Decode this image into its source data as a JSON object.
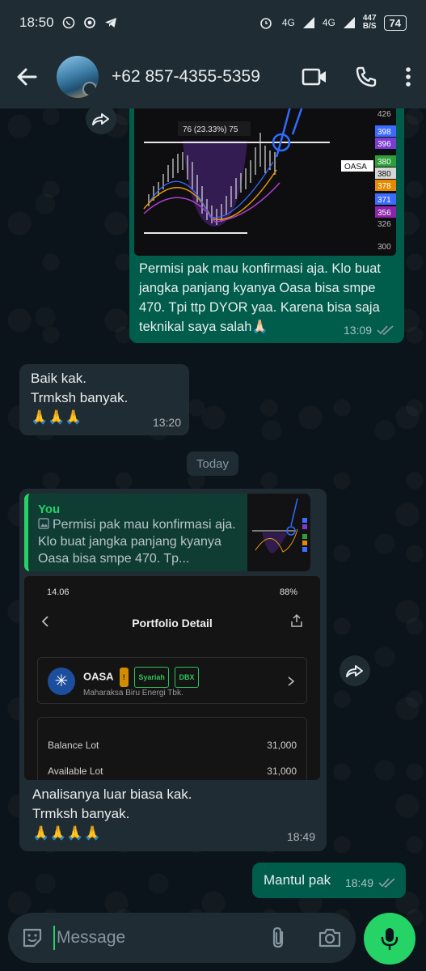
{
  "status_bar": {
    "time": "18:50",
    "net1": "4G",
    "net2": "4G",
    "speed_value": "447",
    "speed_unit": "B/S",
    "battery": "74"
  },
  "header": {
    "contact": "+62 857-4355-5359"
  },
  "chart_msg": {
    "ticker_label": "OASA",
    "callout": "76 (23.33%) 75",
    "price_ticks": [
      "426",
      "398",
      "396",
      "380",
      "380",
      "378",
      "371",
      "356",
      "326",
      "300"
    ],
    "price_tick_colors": [
      "#d0d0d0",
      "#3d6bff",
      "#7a3dd1",
      "#2e9e3a",
      "#d6d6d6",
      "#e58a00",
      "#3d6bff",
      "#8e24aa",
      "#d0d0d0",
      "#d0d0d0"
    ],
    "text": "Permisi pak mau konfirmasi aja. Klo buat jangka panjang kyanya Oasa bisa smpe 470. Tpi ttp DYOR yaa. Karena bisa saja teknikal saya salah🙏🏻",
    "time": "13:09"
  },
  "reply1": {
    "line1": "Baik kak.",
    "line2": "Trmksh banyak.",
    "line3": "🙏🙏🙏",
    "time": "13:20"
  },
  "date_divider": "Today",
  "reply2": {
    "quote_author": "You",
    "quote_text": "Permisi pak mau konfirmasi aja. Klo buat jangka panjang kyanya Oasa bisa smpe 470. Tp...",
    "screenshot": {
      "time": "14.06",
      "battery": "88%",
      "title": "Portfolio Detail",
      "ticker": "OASA",
      "badge_warn": "!",
      "badge_syariah": "Syariah",
      "badge_dbx": "DBX",
      "company": "Maharaksa Biru Energi Tbk.",
      "rows": [
        {
          "label": "Balance Lot",
          "value": "31,000"
        },
        {
          "label": "Available Lot",
          "value": "31,000"
        }
      ]
    },
    "line1": "Analisanya luar biasa kak.",
    "line2": "Trmksh banyak.",
    "line3": "🙏🙏🙏🙏",
    "time": "18:49"
  },
  "sent": {
    "text": "Mantul pak",
    "time": "18:49"
  },
  "input": {
    "placeholder": "Message"
  },
  "colors": {
    "outgoing": "#005c4b",
    "incoming": "#202c33",
    "accent": "#25d366",
    "read_ticks": "#53bdeb"
  }
}
